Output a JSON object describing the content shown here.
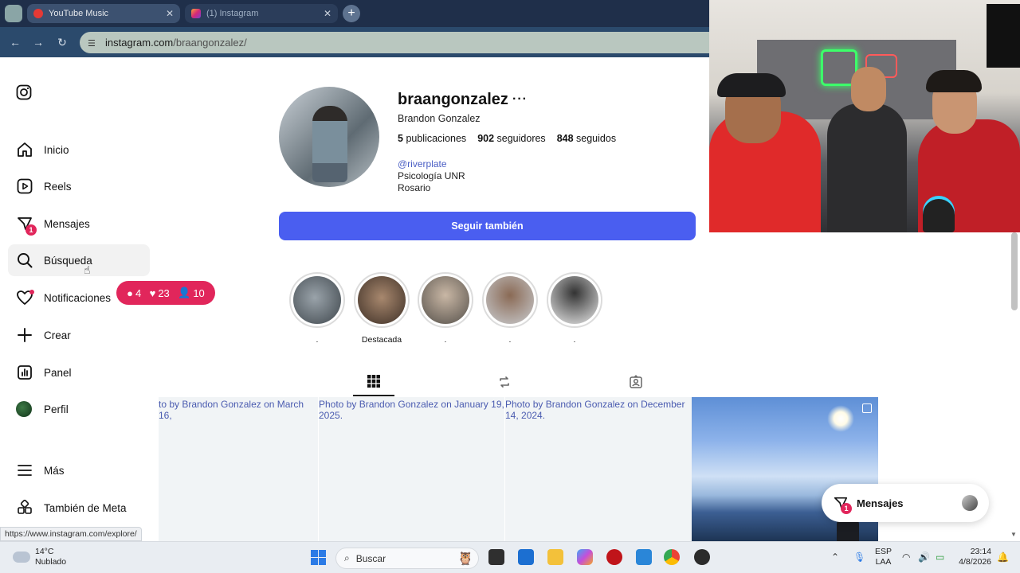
{
  "browser": {
    "tabs": [
      {
        "title": "YouTube Music",
        "active": true
      },
      {
        "title": "(1) Instagram",
        "active": false
      }
    ],
    "url_host": "instagram.com",
    "url_path": "/braangonzalez/",
    "status_url": "https://www.instagram.com/explore/"
  },
  "sidebar": {
    "items": [
      {
        "label": "Inicio",
        "icon": "home-icon"
      },
      {
        "label": "Reels",
        "icon": "reels-icon"
      },
      {
        "label": "Mensajes",
        "icon": "messenger-icon",
        "badge": "1"
      },
      {
        "label": "Búsqueda",
        "icon": "search-icon"
      },
      {
        "label": "Notificaciones",
        "icon": "heart-icon"
      },
      {
        "label": "Crear",
        "icon": "plus-icon"
      },
      {
        "label": "Panel",
        "icon": "chart-icon"
      },
      {
        "label": "Perfil",
        "icon": "avatar"
      },
      {
        "label": "Más",
        "icon": "menu-icon"
      },
      {
        "label": "También de Meta",
        "icon": "meta-icon"
      }
    ],
    "notif_pill": {
      "comments": "4",
      "likes": "23",
      "follows": "10"
    }
  },
  "profile": {
    "username": "braangonzalez",
    "more": "···",
    "full_name": "Brandon Gonzalez",
    "stats": {
      "posts_count": "5",
      "posts_label": "publicaciones",
      "followers_count": "902",
      "followers_label": "seguidores",
      "following_count": "848",
      "following_label": "seguidos"
    },
    "bio_link": "@riverplate",
    "bio_line1": "Psicología UNR",
    "bio_line2": "Rosario",
    "follow_button": "Seguir también"
  },
  "highlights": [
    {
      "label": "."
    },
    {
      "label": "Destacada"
    },
    {
      "label": "."
    },
    {
      "label": "."
    },
    {
      "label": "."
    }
  ],
  "posts": [
    {
      "alt": "to by Brandon Gonzalez on March 16,"
    },
    {
      "alt": "Photo by Brandon Gonzalez on January 19, 2025."
    },
    {
      "alt": "Photo by Brandon Gonzalez on December 14, 2024."
    },
    {
      "alt": ""
    }
  ],
  "messages_float": {
    "label": "Mensajes",
    "badge": "1"
  },
  "taskbar": {
    "temperature": "14°C",
    "weather": "Nublado",
    "search_placeholder": "Buscar",
    "lang1": "ESP",
    "lang2": "LAA",
    "time": "23:14",
    "date": "4/8/2026"
  },
  "colors": {
    "accent": "#4a5ef0",
    "notif": "#e1265b"
  }
}
